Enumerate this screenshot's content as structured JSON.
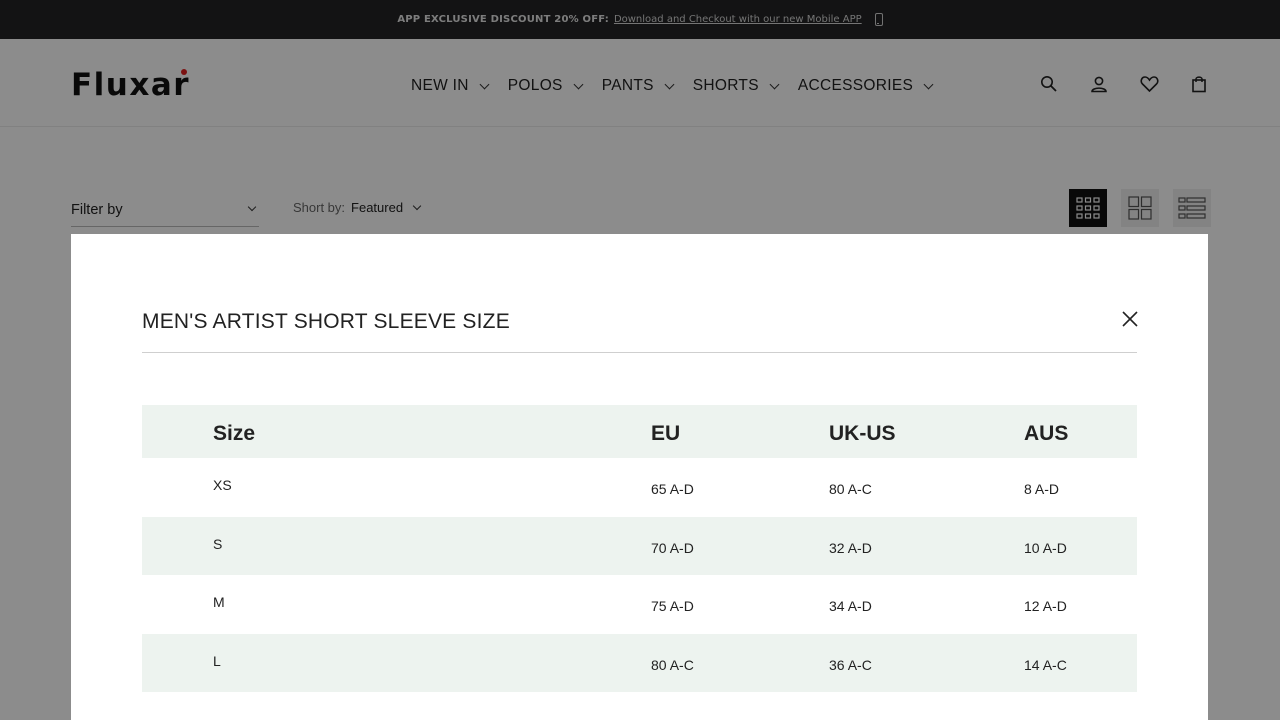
{
  "announcement": {
    "label": "APP EXCLUSIVE DISCOUNT 20% OFF:",
    "link": "Download and Checkout with our new Mobile APP",
    "icon": "phone-icon"
  },
  "brand": {
    "logo": "Fluxar",
    "accent": "#e02020"
  },
  "nav": [
    {
      "label": "NEW IN"
    },
    {
      "label": "POLOS"
    },
    {
      "label": "PANTS"
    },
    {
      "label": "SHORTS"
    },
    {
      "label": "ACCESSORIES"
    }
  ],
  "header_icons": [
    "search-icon",
    "account-icon",
    "wishlist-icon",
    "cart-icon"
  ],
  "toolbar": {
    "filter_label": "Filter by",
    "sort_label": "Short by:",
    "sort_value": "Featured",
    "views": [
      "grid-4-icon",
      "grid-2-icon",
      "list-icon"
    ],
    "active_view": "grid-4-icon"
  },
  "modal": {
    "title": "MEN'S ARTIST SHORT SLEEVE SIZE",
    "close_icon": "close-icon",
    "table": {
      "headers": [
        "Size",
        "EU",
        "UK-US",
        "AUS"
      ],
      "rows": [
        [
          "XS",
          "65 A-D",
          "80 A-C",
          "8 A-D"
        ],
        [
          "S",
          "70 A-D",
          "32 A-D",
          "10 A-D"
        ],
        [
          "M",
          "75 A-D",
          "34 A-D",
          "12 A-D"
        ],
        [
          "L",
          "80 A-C",
          "36 A-C",
          "14 A-C"
        ]
      ],
      "row_highlight": "#edf3ef"
    }
  }
}
